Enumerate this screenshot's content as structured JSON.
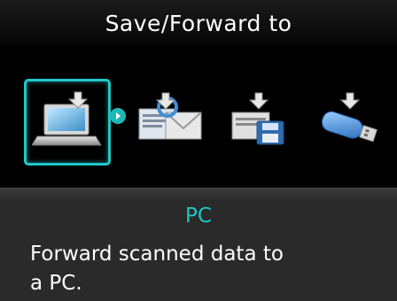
{
  "header": {
    "title": "Save/Forward to"
  },
  "destinations": [
    {
      "icon": "pc-laptop-icon",
      "selected": true
    },
    {
      "icon": "network-folder-icon",
      "selected": false
    },
    {
      "icon": "memory-card-icon",
      "selected": false
    },
    {
      "icon": "usb-flash-drive-icon",
      "selected": false
    }
  ],
  "selection": {
    "name": "PC",
    "description_line1": "Forward scanned data to",
    "description_line2": "a PC."
  },
  "colors": {
    "accent": "#22c6c6",
    "background": "#000000",
    "panel": "#2a2a2a"
  }
}
